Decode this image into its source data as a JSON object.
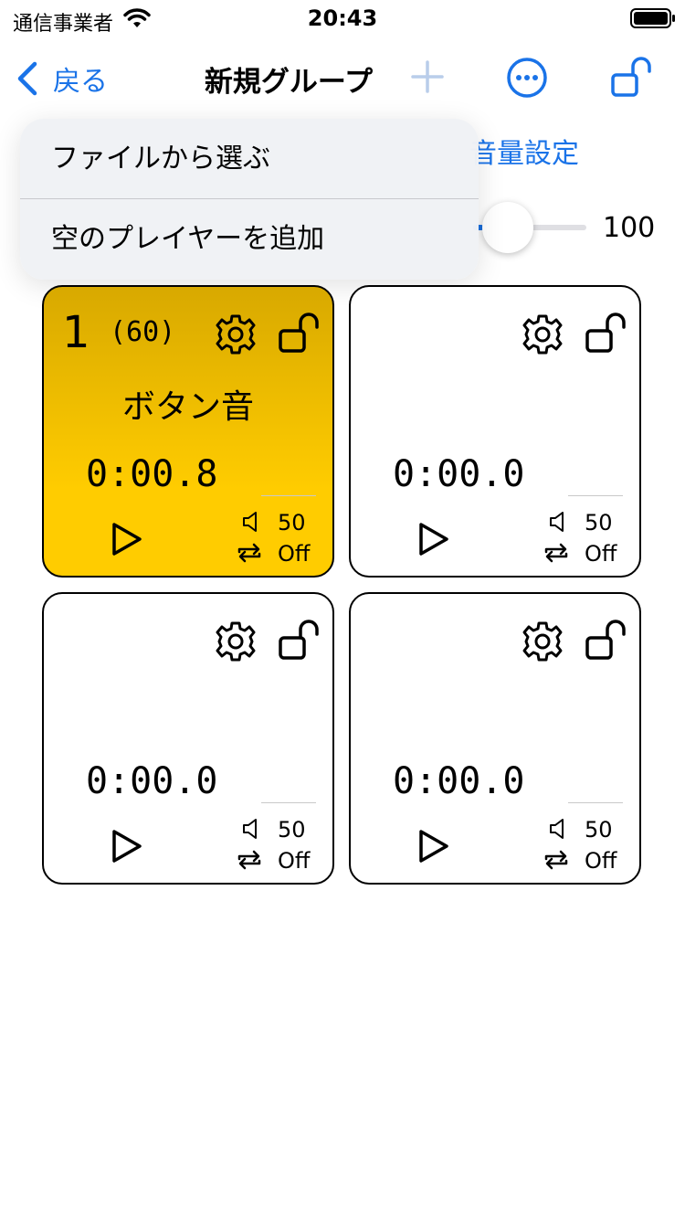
{
  "status_bar": {
    "carrier": "通信事業者",
    "time": "20:43"
  },
  "nav": {
    "back_label": "戻る",
    "title": "新規グループ"
  },
  "menu": {
    "items": [
      {
        "label": "ファイルから選ぶ"
      },
      {
        "label": "空のプレイヤーを追加"
      }
    ]
  },
  "volume": {
    "title": "音量設定",
    "value": "100"
  },
  "cards": [
    {
      "number": "1",
      "count": "(60)",
      "name": "ボタン音",
      "time": "0:00.8",
      "volume": "50",
      "loop": "Off",
      "active": true
    },
    {
      "number": "",
      "count": "",
      "name": "",
      "time": "0:00.0",
      "volume": "50",
      "loop": "Off",
      "active": false
    },
    {
      "number": "",
      "count": "",
      "name": "",
      "time": "0:00.0",
      "volume": "50",
      "loop": "Off",
      "active": false
    },
    {
      "number": "",
      "count": "",
      "name": "",
      "time": "0:00.0",
      "volume": "50",
      "loop": "Off",
      "active": false
    }
  ],
  "colors": {
    "accent": "#1a73e8",
    "active_card": "#ffcc00"
  }
}
